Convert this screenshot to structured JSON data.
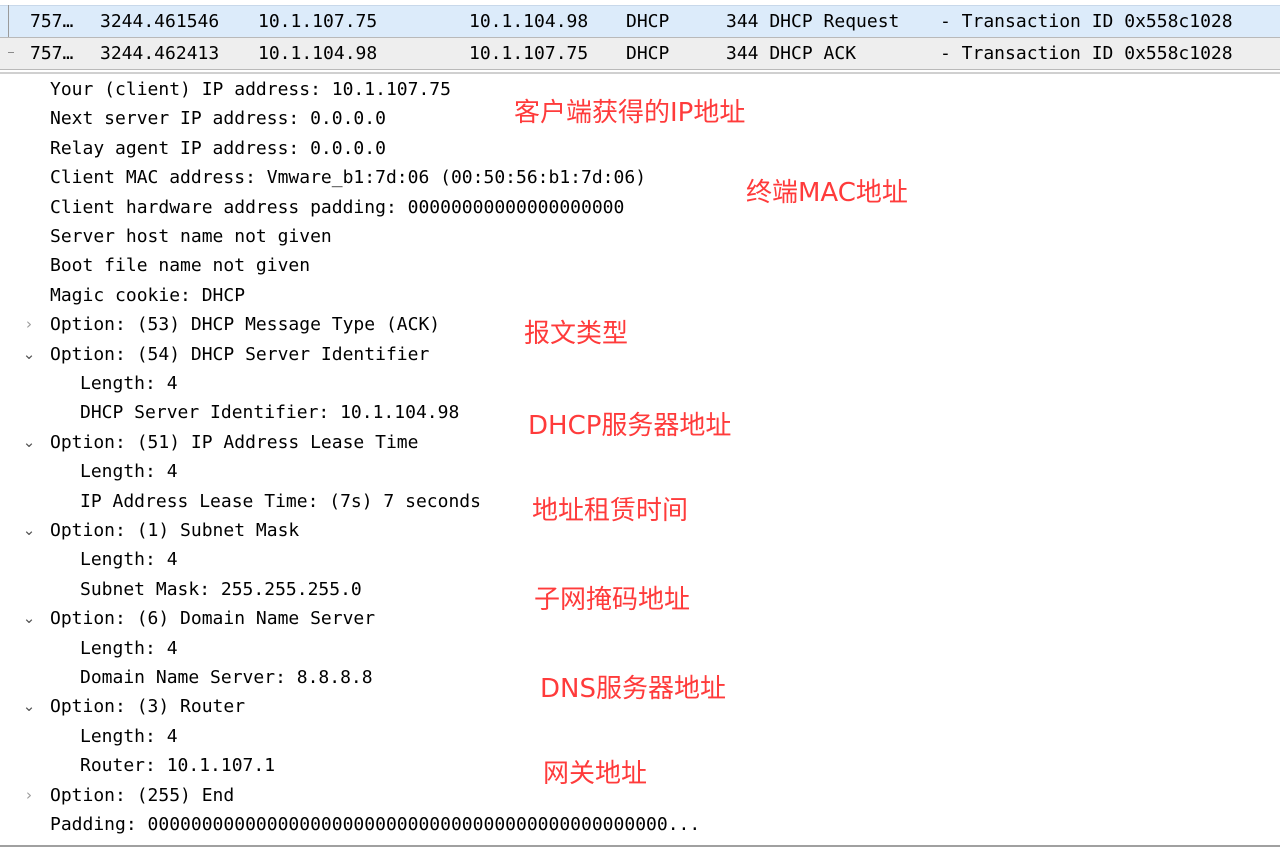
{
  "packet_list": {
    "rows": [
      {
        "no": "757…",
        "time": "3244.461546",
        "source": "10.1.107.75",
        "destination": "10.1.104.98",
        "protocol": "DHCP",
        "length_info": "344 DHCP Request",
        "transaction": "- Transaction ID 0x558c1028",
        "selected": true
      },
      {
        "no": "757…",
        "time": "3244.462413",
        "source": "10.1.104.98",
        "destination": "10.1.107.75",
        "protocol": "DHCP",
        "length_info": "344 DHCP ACK",
        "transaction": "- Transaction ID 0x558c1028",
        "selected": false
      }
    ]
  },
  "details": {
    "items": [
      {
        "text": "Your (client) IP address: 10.1.107.75",
        "level": 0,
        "expander": "none"
      },
      {
        "text": "Next server IP address: 0.0.0.0",
        "level": 0,
        "expander": "none"
      },
      {
        "text": "Relay agent IP address: 0.0.0.0",
        "level": 0,
        "expander": "none"
      },
      {
        "text": "Client MAC address: Vmware_b1:7d:06 (00:50:56:b1:7d:06)",
        "level": 0,
        "expander": "none"
      },
      {
        "text": "Client hardware address padding: 00000000000000000000",
        "level": 0,
        "expander": "none"
      },
      {
        "text": "Server host name not given",
        "level": 0,
        "expander": "none"
      },
      {
        "text": "Boot file name not given",
        "level": 0,
        "expander": "none"
      },
      {
        "text": "Magic cookie: DHCP",
        "level": 0,
        "expander": "none"
      },
      {
        "text": "Option: (53) DHCP Message Type (ACK)",
        "level": 0,
        "expander": "collapsed"
      },
      {
        "text": "Option: (54) DHCP Server Identifier",
        "level": 0,
        "expander": "expanded"
      },
      {
        "text": "Length: 4",
        "level": 1,
        "expander": "none"
      },
      {
        "text": "DHCP Server Identifier: 10.1.104.98",
        "level": 1,
        "expander": "none"
      },
      {
        "text": "Option: (51) IP Address Lease Time",
        "level": 0,
        "expander": "expanded"
      },
      {
        "text": "Length: 4",
        "level": 1,
        "expander": "none"
      },
      {
        "text": "IP Address Lease Time: (7s) 7 seconds",
        "level": 1,
        "expander": "none"
      },
      {
        "text": "Option: (1) Subnet Mask",
        "level": 0,
        "expander": "expanded"
      },
      {
        "text": "Length: 4",
        "level": 1,
        "expander": "none"
      },
      {
        "text": "Subnet Mask: 255.255.255.0",
        "level": 1,
        "expander": "none"
      },
      {
        "text": "Option: (6) Domain Name Server",
        "level": 0,
        "expander": "expanded"
      },
      {
        "text": "Length: 4",
        "level": 1,
        "expander": "none"
      },
      {
        "text": "Domain Name Server: 8.8.8.8",
        "level": 1,
        "expander": "none"
      },
      {
        "text": "Option: (3) Router",
        "level": 0,
        "expander": "expanded"
      },
      {
        "text": "Length: 4",
        "level": 1,
        "expander": "none"
      },
      {
        "text": "Router: 10.1.107.1",
        "level": 1,
        "expander": "none"
      },
      {
        "text": "Option: (255) End",
        "level": 0,
        "expander": "collapsed"
      },
      {
        "text": "Padding: 000000000000000000000000000000000000000000000000...",
        "level": 0,
        "expander": "none"
      }
    ],
    "expander_glyphs": {
      "collapsed": "›",
      "expanded": "⌄"
    }
  },
  "annotations": {
    "client_ip": "客户端获得的IP地址",
    "mac": "终端MAC地址",
    "msg_type": "报文类型",
    "dhcp_server": "DHCP服务器地址",
    "lease_time": "地址租赁时间",
    "subnet_mask": "子网掩码地址",
    "dns_server": "DNS服务器地址",
    "gateway": "网关地址",
    "color": "#ff3b3b"
  }
}
